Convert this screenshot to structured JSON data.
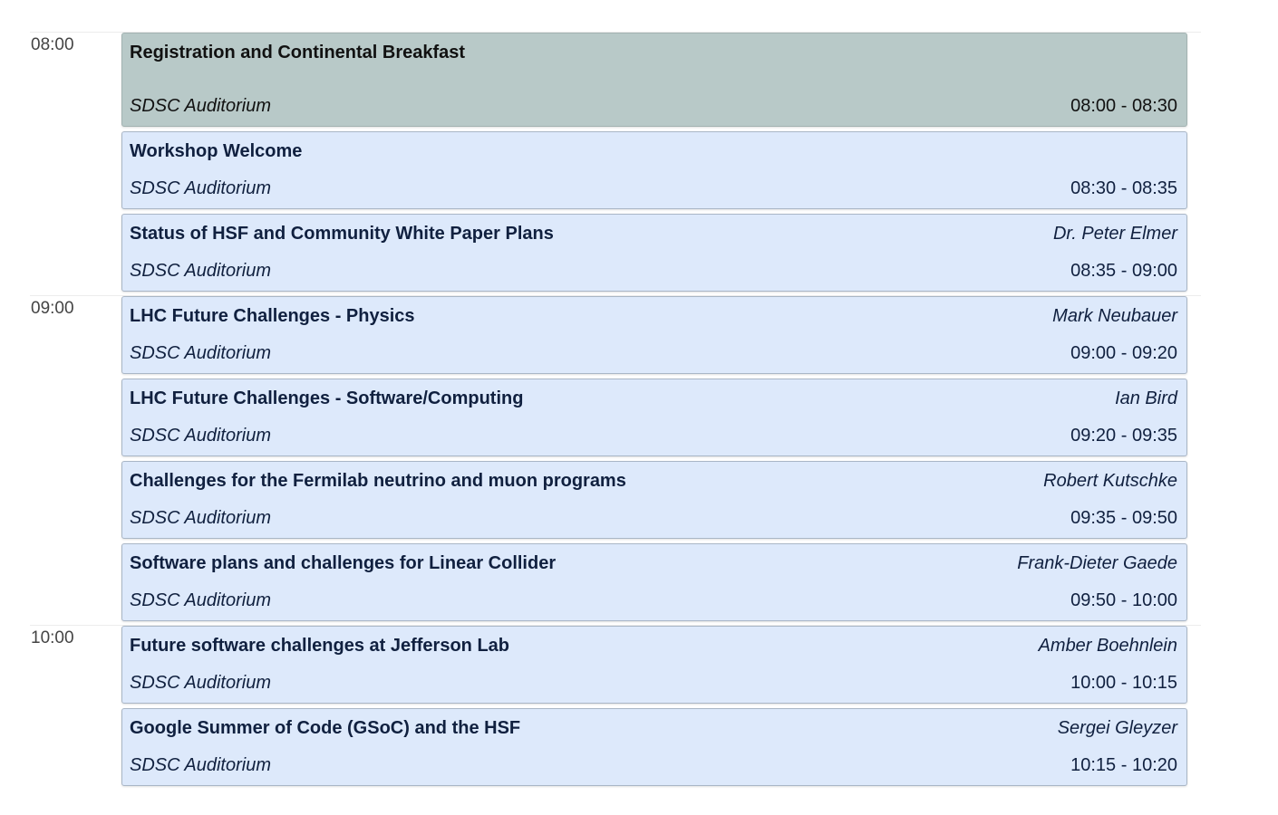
{
  "hours": [
    "08:00",
    "09:00",
    "10:00"
  ],
  "entries": [
    {
      "title": "Registration and Continental Breakfast",
      "speaker": "",
      "room": "SDSC Auditorium",
      "time": "08:00 - 08:30"
    },
    {
      "title": "Workshop Welcome",
      "speaker": "",
      "room": "SDSC Auditorium",
      "time": "08:30 - 08:35"
    },
    {
      "title": "Status of HSF and Community White Paper Plans",
      "speaker": "Dr. Peter Elmer",
      "room": "SDSC Auditorium",
      "time": "08:35 - 09:00"
    },
    {
      "title": "LHC Future Challenges - Physics",
      "speaker": "Mark Neubauer",
      "room": "SDSC Auditorium",
      "time": "09:00 - 09:20"
    },
    {
      "title": "LHC Future Challenges - Software/Computing",
      "speaker": "Ian Bird",
      "room": "SDSC Auditorium",
      "time": "09:20 - 09:35"
    },
    {
      "title": "Challenges for the Fermilab neutrino and muon programs",
      "speaker": "Robert Kutschke",
      "room": "SDSC Auditorium",
      "time": "09:35 - 09:50"
    },
    {
      "title": "Software plans and challenges for Linear Collider",
      "speaker": "Frank-Dieter Gaede",
      "room": "SDSC Auditorium",
      "time": "09:50 - 10:00"
    },
    {
      "title": "Future software challenges at Jefferson Lab",
      "speaker": "Amber Boehnlein",
      "room": "SDSC Auditorium",
      "time": "10:00 - 10:15"
    },
    {
      "title": "Google Summer of Code (GSoC) and the HSF",
      "speaker": "Sergei Gleyzer",
      "room": "SDSC Auditorium",
      "time": "10:15 - 10:20"
    }
  ],
  "colors": {
    "break_bg": "#b8c9c8",
    "contribution_bg": "#dde9fb",
    "contribution_text": "#10203f"
  }
}
